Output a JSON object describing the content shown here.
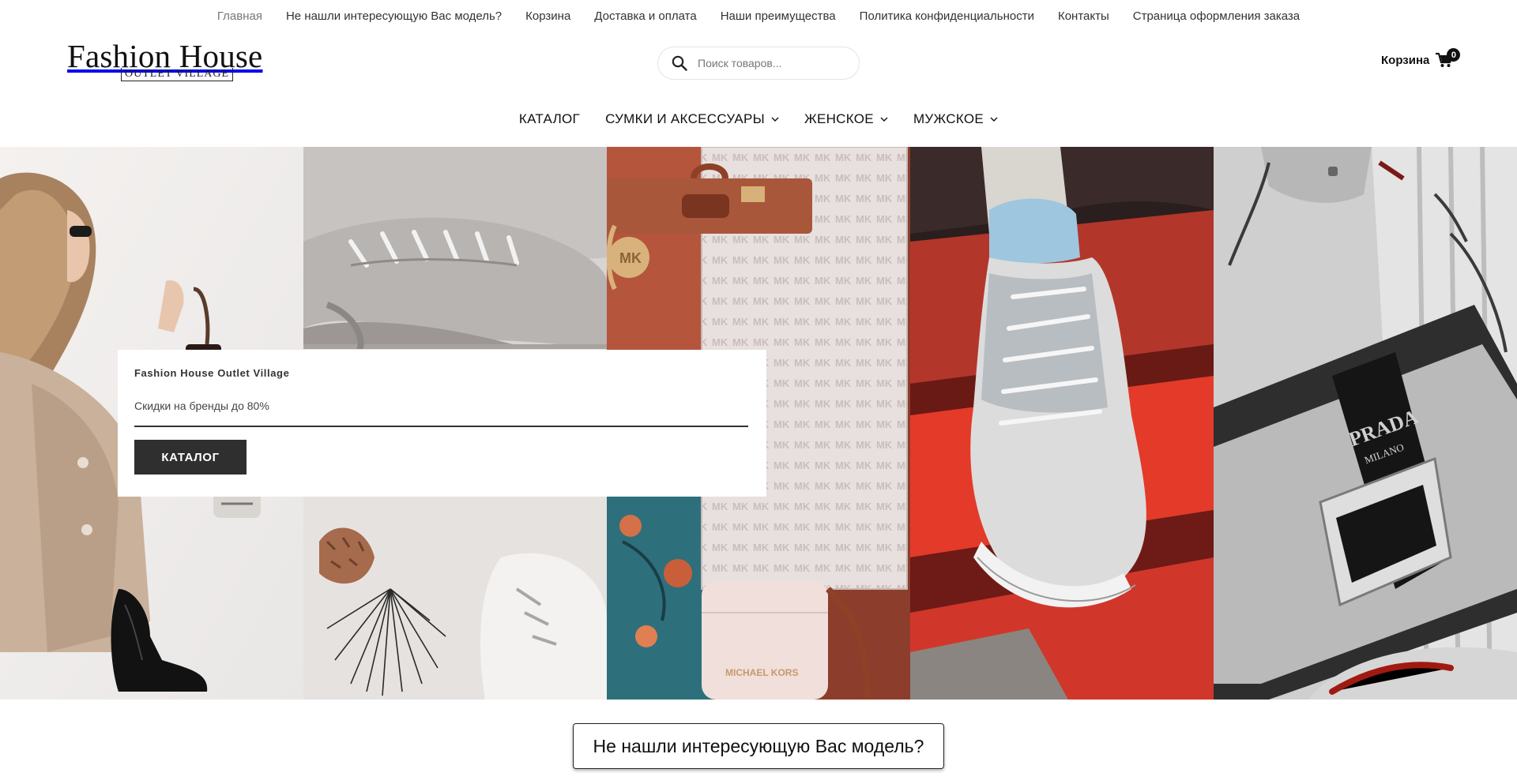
{
  "topnav": {
    "items": [
      {
        "label": "Главная",
        "active": true
      },
      {
        "label": "Не нашли интересующую Вас модель?"
      },
      {
        "label": "Корзина"
      },
      {
        "label": "Доставка и оплата"
      },
      {
        "label": "Наши преимущества"
      },
      {
        "label": "Политика конфиденциальности"
      },
      {
        "label": "Контакты"
      },
      {
        "label": "Страница оформления заказа"
      }
    ]
  },
  "header": {
    "logo_title": "Fashion House",
    "logo_subtitle": "OUTLET VILLAGE",
    "search_placeholder": "Поиск товаров...",
    "cart_label": "Корзина",
    "cart_count": "0"
  },
  "mainmenu": {
    "items": [
      {
        "label": "КАТАЛОГ",
        "dropdown": false
      },
      {
        "label": "СУМКИ И АКСЕССУАРЫ",
        "dropdown": true
      },
      {
        "label": "ЖЕНСКОЕ",
        "dropdown": true
      },
      {
        "label": "МУЖСКОЕ",
        "dropdown": true
      }
    ]
  },
  "hero": {
    "promo_brand": "Fashion House Outlet Village",
    "promo_text": "Скидки на бренды до 80%",
    "promo_button": "КАТАЛОГ",
    "panel5_brand": "PRADA",
    "panel5_sub": "MILANO",
    "panel3_brand": "MICHAEL KORS"
  },
  "cta": {
    "label": "Не нашли интересующую Вас модель?"
  },
  "colors": {
    "button_bg": "#2f2f2f",
    "accent_red": "#d42d22",
    "text": "#222222"
  }
}
